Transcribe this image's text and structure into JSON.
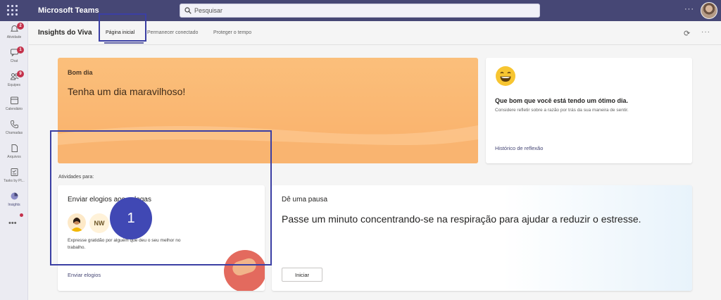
{
  "app": {
    "title": "Microsoft Teams"
  },
  "search": {
    "placeholder": "Pesquisar"
  },
  "rail": {
    "items": [
      {
        "label": "Atividade",
        "icon": "bell-icon",
        "badge": "2"
      },
      {
        "label": "Chat",
        "icon": "chat-icon",
        "badge": "1"
      },
      {
        "label": "Equipes",
        "icon": "teams-icon",
        "badge": "9"
      },
      {
        "label": "Calendário",
        "icon": "calendar-icon",
        "badge": ""
      },
      {
        "label": "Chamadas",
        "icon": "phone-icon",
        "badge": ""
      },
      {
        "label": "Arquivos",
        "icon": "file-icon",
        "badge": ""
      },
      {
        "label": "Tasks by Pl...",
        "icon": "tasks-icon",
        "badge": ""
      },
      {
        "label": "Insights",
        "icon": "insights-icon",
        "badge": ""
      }
    ],
    "more": "•••"
  },
  "header": {
    "title": "Insights do Viva",
    "tabs": [
      {
        "label": "Página inicial"
      },
      {
        "label": "Permanecer conectado"
      },
      {
        "label": "Proteger o tempo"
      }
    ],
    "more": "···"
  },
  "hero": {
    "title": "Bom dia",
    "subtitle": "Tenha um dia maravilhoso!"
  },
  "reflection": {
    "title": "Que bom que você está tendo um ótimo dia.",
    "description": "Considere refletir sobre a razão por trás da sua maneira de sentir.",
    "link": "Histórico de reflexão"
  },
  "activities": {
    "label": "Atividades para:"
  },
  "praise": {
    "title": "Enviar elogios aos colegas",
    "avatar_initials": "NW",
    "description": "Expresse gratidão por alguém que deu o seu melhor no trabalho.",
    "link": "Enviar elogios"
  },
  "pause": {
    "title": "Dê uma pausa",
    "subtitle": "Passe um minuto concentrando-se na respiração para ajudar a reduzir o estresse.",
    "button": "Iniciar"
  },
  "callout": {
    "number": "1"
  },
  "colors": {
    "brand": "#464775",
    "accent": "#6264a7",
    "callout": "#3b3fa4",
    "hero": "#f9b06a"
  }
}
